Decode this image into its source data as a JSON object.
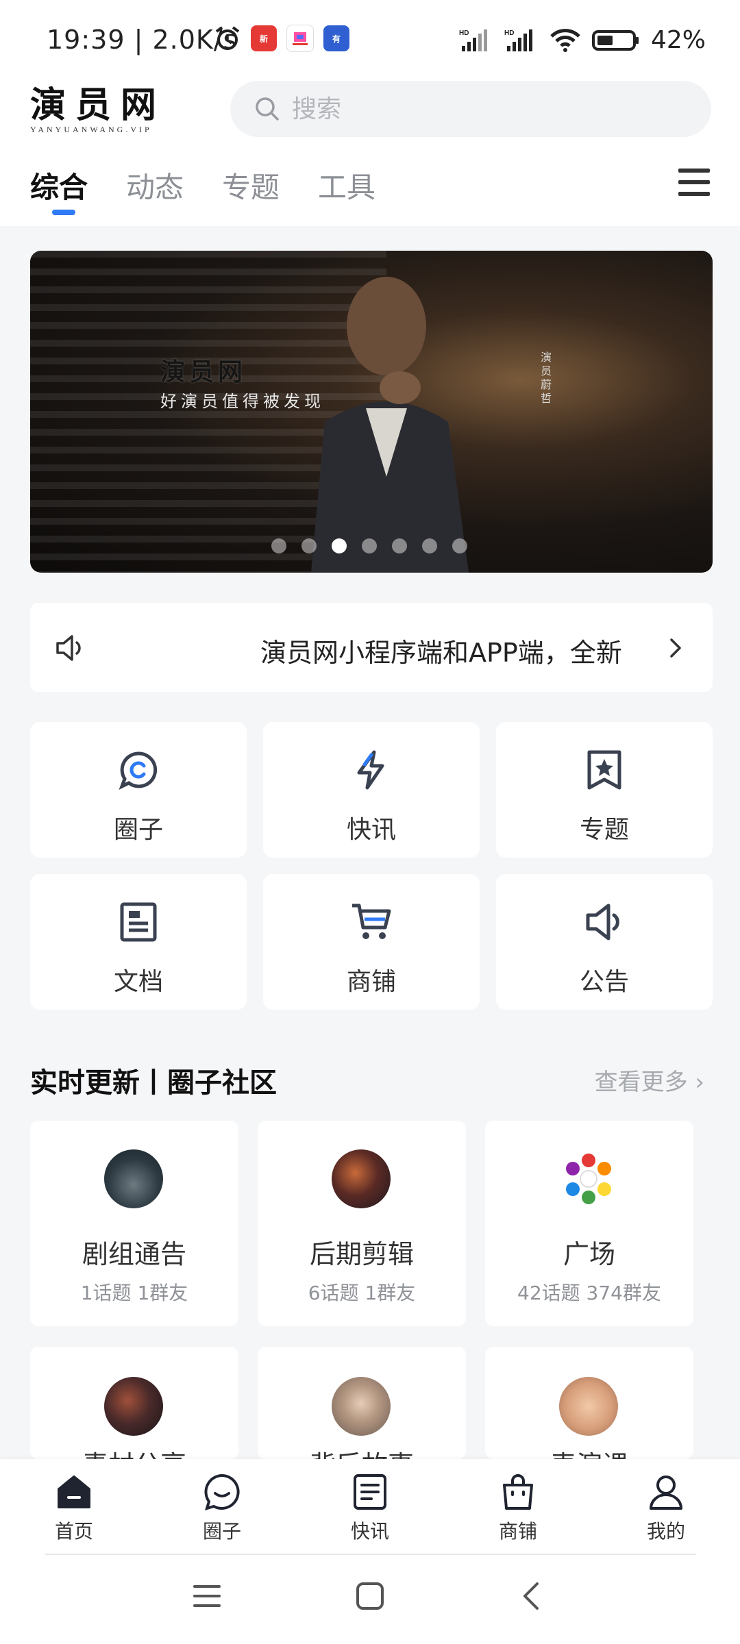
{
  "status_bar": {
    "time": "19:39",
    "speed": "2.0K/s",
    "battery_text": "42%",
    "icons": [
      "alarm-icon",
      "app-badge-icon",
      "app-badge-icon",
      "app-badge-icon",
      "hd-signal-icon",
      "hd-signal-icon",
      "wifi-icon",
      "battery-icon"
    ]
  },
  "header": {
    "logo_text": "演员网",
    "logo_sub": "YANYUANWANG.VIP",
    "search_placeholder": "搜索"
  },
  "tabs": [
    {
      "label": "综合",
      "active": true
    },
    {
      "label": "动态",
      "active": false
    },
    {
      "label": "专题",
      "active": false
    },
    {
      "label": "工具",
      "active": false
    }
  ],
  "banner": {
    "logo_text": "演员网",
    "slogan": "好演员值得被发现",
    "vertical_text": "演员 蔚哲",
    "active_dot": 3,
    "dot_count": 7
  },
  "notice": {
    "text": "演员网小程序端和APP端，全新"
  },
  "grid": [
    {
      "label": "圈子",
      "icon": "circle-chat-icon"
    },
    {
      "label": "快讯",
      "icon": "lightning-icon"
    },
    {
      "label": "专题",
      "icon": "bookmark-star-icon"
    },
    {
      "label": "文档",
      "icon": "document-icon"
    },
    {
      "label": "商铺",
      "icon": "cart-icon"
    },
    {
      "label": "公告",
      "icon": "speaker-icon"
    }
  ],
  "section": {
    "title": "实时更新丨圈子社区",
    "more": "查看更多"
  },
  "circles": [
    {
      "name": "剧组通告",
      "stats": "1话题  1群友"
    },
    {
      "name": "后期剪辑",
      "stats": "6话题  1群友"
    },
    {
      "name": "广场",
      "stats": "42话题  374群友"
    },
    {
      "name": "素材分享",
      "stats": ""
    },
    {
      "name": "背后故事",
      "stats": ""
    },
    {
      "name": "表演课",
      "stats": ""
    }
  ],
  "bottom_nav": [
    {
      "label": "首页",
      "icon": "home-icon",
      "active": true
    },
    {
      "label": "圈子",
      "icon": "circle-chat-icon"
    },
    {
      "label": "快讯",
      "icon": "news-icon"
    },
    {
      "label": "商铺",
      "icon": "shopping-bag-icon"
    },
    {
      "label": "我的",
      "icon": "person-icon"
    }
  ],
  "colors": {
    "accent": "#2f7bf6",
    "icon_dark": "#3a4150",
    "background": "#f5f6f8"
  }
}
